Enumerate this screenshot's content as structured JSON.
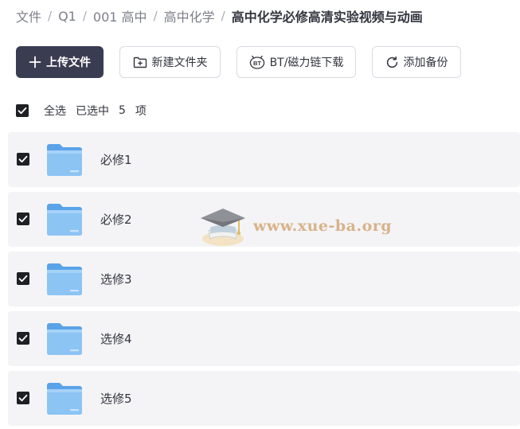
{
  "breadcrumb": {
    "items": [
      "文件",
      "Q1",
      "001 高中",
      "高中化学"
    ],
    "current": "高中化学必修高清实验视频与动画",
    "separator": "/"
  },
  "toolbar": {
    "upload_label": "上传文件",
    "new_folder_label": "新建文件夹",
    "bt_download_label": "BT/磁力链下载",
    "add_backup_label": "添加备份",
    "bt_icon_text": "BT"
  },
  "selection": {
    "select_all_label": "全选",
    "selected_prefix": "已选中",
    "selected_count": "5",
    "selected_suffix": "项"
  },
  "files": [
    {
      "name": "必修1",
      "checked": true
    },
    {
      "name": "必修2",
      "checked": true
    },
    {
      "name": "选修3",
      "checked": true
    },
    {
      "name": "选修4",
      "checked": true
    },
    {
      "name": "选修5",
      "checked": true
    }
  ],
  "watermark": {
    "text": "www.xue-ba.org"
  },
  "colors": {
    "primary_button": "#3a3c52",
    "row_background": "#f4f4f6",
    "folder_blue": "#7ab8f0",
    "checkbox": "#1f2023",
    "watermark": "#d4a878"
  },
  "icons": {
    "upload": "plus-icon",
    "new_folder": "folder-plus-icon",
    "bt": "bt-icon",
    "backup": "refresh-icon",
    "checkbox": "check-icon",
    "folder": "folder-icon",
    "watermark_logo": "graduation-cap-icon"
  }
}
